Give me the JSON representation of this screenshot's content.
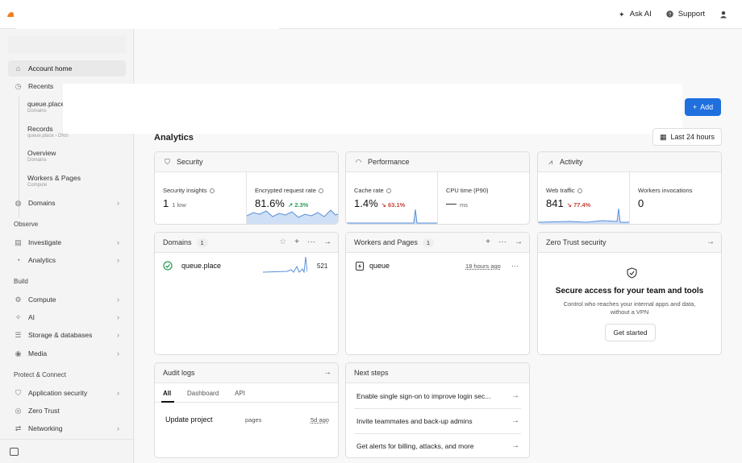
{
  "topbar": {
    "ask_ai": "Ask AI",
    "support": "Support"
  },
  "sidebar": {
    "account_home": "Account home",
    "recents": "Recents",
    "recent_items": [
      {
        "title": "queue.place",
        "subtitle": "Domains"
      },
      {
        "title": "Records",
        "subtitle": "queue.place  ›  DNS"
      },
      {
        "title": "Overview",
        "subtitle": "Domains"
      },
      {
        "title": "Workers & Pages",
        "subtitle": "Compute"
      }
    ],
    "domains": "Domains",
    "observe": "Observe",
    "investigate": "Investigate",
    "analytics": "Analytics",
    "build": "Build",
    "compute": "Compute",
    "ai": "AI",
    "storage": "Storage & databases",
    "media": "Media",
    "protect": "Protect & Connect",
    "app_security": "Application security",
    "zero_trust": "Zero Trust",
    "networking": "Networking"
  },
  "header": {
    "add_label": "Add",
    "analytics_title": "Analytics",
    "time_range": "Last 24 hours"
  },
  "security": {
    "title": "Security",
    "insights_label": "Security insights",
    "insights_value": "1",
    "insights_sub": "1 low",
    "encrypted_label": "Encrypted request rate",
    "encrypted_value": "81.6%",
    "encrypted_change": "2.3%"
  },
  "performance": {
    "title": "Performance",
    "cache_label": "Cache rate",
    "cache_value": "1.4%",
    "cache_change": "63.1%",
    "cpu_label": "CPU time (P90)",
    "cpu_value": "—",
    "cpu_unit": "ms"
  },
  "activity": {
    "title": "Activity",
    "web_label": "Web traffic",
    "web_value": "841",
    "web_change": "77.4%",
    "workers_label": "Workers invocations",
    "workers_value": "0"
  },
  "domains_card": {
    "title": "Domains",
    "count": "1",
    "domain": "queue.place",
    "requests": "521"
  },
  "workers_card": {
    "title": "Workers and Pages",
    "count": "1",
    "name": "queue",
    "time": "18 hours ago"
  },
  "zero_trust_card": {
    "title": "Zero Trust security",
    "heading": "Secure access for your team and tools",
    "desc_line1": "Control who reaches your internal apps and data,",
    "desc_line2": "without a VPN",
    "button": "Get started"
  },
  "audit_card": {
    "title": "Audit logs",
    "tabs": [
      "All",
      "Dashboard",
      "API"
    ],
    "entry_action": "Update project",
    "entry_resource": "pages",
    "entry_time": "5d ago"
  },
  "next_steps": {
    "title": "Next steps",
    "items": [
      "Enable single sign-on to improve login sec...",
      "Invite teammates and back-up admins",
      "Get alerts for billing, attacks, and more"
    ]
  },
  "colors": {
    "accent": "#1f6fde",
    "positive": "#2e9e5b",
    "negative": "#c8443a",
    "sparkline": "#5b8fd9"
  }
}
